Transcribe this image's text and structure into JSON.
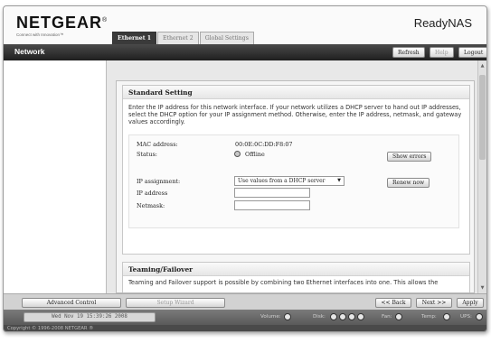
{
  "header": {
    "brand": "NETGEAR",
    "brand_mark": "®",
    "tagline": "Connect with Innovation™",
    "product": "ReadyNAS"
  },
  "tabs": [
    {
      "label": "Ethernet 1",
      "active": true
    },
    {
      "label": "Ethernet 2",
      "active": false
    },
    {
      "label": "Global Settings",
      "active": false
    }
  ],
  "titlebar": {
    "section": "Network",
    "refresh": "Refresh",
    "help": "Help",
    "logout": "Logout"
  },
  "standard": {
    "title": "Standard Setting",
    "description": "Enter the IP address for this network interface. If your network utilizes a DHCP server to hand out IP addresses, select the DHCP option for your IP assignment method. Otherwise, enter the IP address, netmask, and gateway values accordingly.",
    "mac_label": "MAC address:",
    "mac_value": "00:0E:0C:DD:F8:07",
    "status_label": "Status:",
    "status_value": "Offline",
    "show_errors": "Show errors",
    "ip_assignment_label": "IP assignment:",
    "ip_assignment_value": "Use values from a DHCP server",
    "renew_now": "Renew now",
    "ip_address_label": "IP address",
    "netmask_label": "Netmask:"
  },
  "teaming": {
    "title": "Teaming/Failover",
    "description": "Teaming and Failover support is possible by combining two Ethernet interfaces into one. This allows the"
  },
  "actions": {
    "advanced": "Advanced Control",
    "wizard": "Setup Wizard",
    "back": "<< Back",
    "next": "Next >>",
    "apply": "Apply"
  },
  "statusbar": {
    "datetime": "Wed Nov 19  15:39:26 2008",
    "volume": "Volume:",
    "disk": "Disk:",
    "fan": "Fan:",
    "temp": "Temp:",
    "ups": "UPS:"
  },
  "copyright": "Copyright © 1996-2008 NETGEAR ®"
}
